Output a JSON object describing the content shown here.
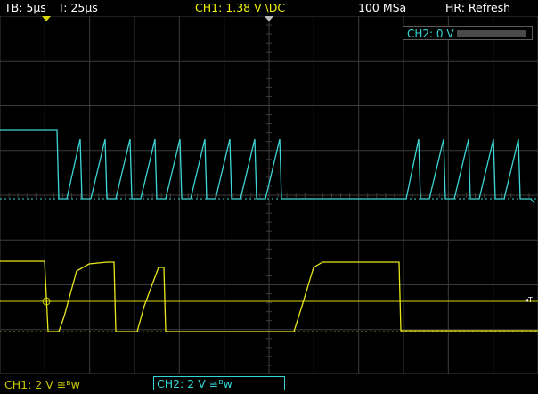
{
  "header": {
    "timebase": "TB: 5µs",
    "trigger_time": "T: 25µs",
    "ch1_trigger": "CH1: 1.38 V \\DC",
    "sample_rate": "100 MSa",
    "acquire_mode": "HR: Refresh"
  },
  "ch2_offset_label": "CH2: 0 V",
  "footer": {
    "ch1_scale": "CH1: 2 V ≅ᴮᴡ",
    "ch2_scale": "CH2: 2 V ≅ᴮᴡ"
  },
  "trigger_marker": "◂T",
  "colors": {
    "grid": "#3c3c3c",
    "ch1": "#e8e81a",
    "ch2": "#3ed6d6",
    "trigger_level": "#d8d800"
  },
  "traces": {
    "ch2_points": "0,128 64,128 66,205 75,205 90,138 92,205 102,205 118,138 120,205 130,205 146,138 148,205 158,205 174,138 176,205 186,205 202,138 204,205 214,205 230,138 232,205 242,205 258,138 260,205 270,205 286,138 288,205 298,205 314,138 316,205 326,205 450,205 456,205 470,138 472,205 482,205 498,138 500,205 510,205 526,138 528,205 538,205 554,138 556,205 566,205 582,138 584,205 596,205 600,210",
    "ch1_points": "0,275 50,275 54,354 66,354 72,337 86,286 100,278 120,276 128,276 130,354 154,354 162,325 178,282 184,282 186,354 330,354 340,322 352,282 362,276 448,276 450,353 604,353"
  }
}
